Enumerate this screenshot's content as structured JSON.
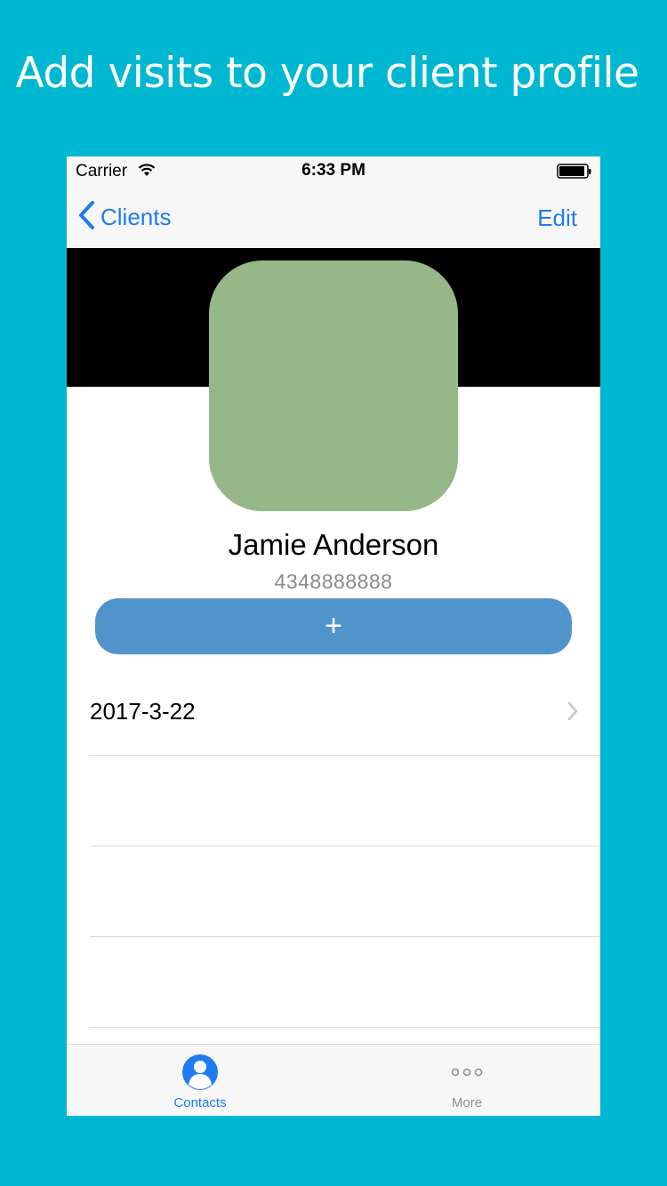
{
  "headline": "Add visits to your client profile",
  "status_bar": {
    "carrier": "Carrier",
    "time": "6:33 PM"
  },
  "nav": {
    "back_label": "Clients",
    "edit_label": "Edit"
  },
  "profile": {
    "name": "Jamie Anderson",
    "phone": "4348888888"
  },
  "add_button_label": "+",
  "visits": [
    {
      "date": "2017-3-22"
    },
    {
      "date": ""
    },
    {
      "date": ""
    },
    {
      "date": ""
    }
  ],
  "tabbar": {
    "tabs": [
      {
        "label": "Contacts",
        "icon": "contacts-icon",
        "active": true
      },
      {
        "label": "More",
        "icon": "more-icon",
        "active": false
      }
    ]
  },
  "colors": {
    "background": "#00b7d1",
    "accent": "#1f7bf0",
    "avatar": "#96b888",
    "add_button": "#5094cb"
  }
}
